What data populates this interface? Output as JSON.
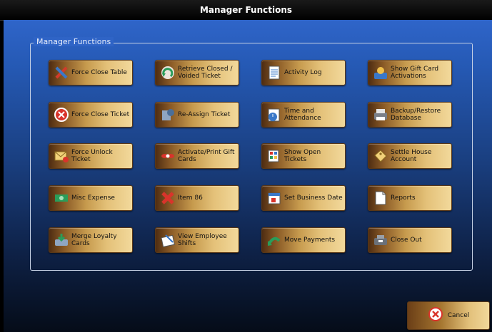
{
  "window": {
    "title": "Manager Functions"
  },
  "group": {
    "label": "Manager Functions"
  },
  "buttons": [
    {
      "name": "force-close-table-button",
      "icon": "tools-icon",
      "label": "Force Close Table"
    },
    {
      "name": "retrieve-closed-voided-ticket-button",
      "icon": "retrieve-arrow-icon",
      "label": "Retrieve Closed / Voided Ticket"
    },
    {
      "name": "activity-log-button",
      "icon": "log-document-icon",
      "label": "Activity Log"
    },
    {
      "name": "show-gift-card-activations-button",
      "icon": "user-card-icon",
      "label": "Show Gift Card Activations"
    },
    {
      "name": "force-close-ticket-button",
      "icon": "stop-circle-icon",
      "label": "Force Close Ticket"
    },
    {
      "name": "re-assign-ticket-button",
      "icon": "reassign-icon",
      "label": "Re-Assign Ticket"
    },
    {
      "name": "time-and-attendance-button",
      "icon": "timesheet-icon",
      "label": "Time and Attendance"
    },
    {
      "name": "backup-restore-database-button",
      "icon": "printer-disk-icon",
      "label": "Backup/Restore Database"
    },
    {
      "name": "force-unlock-ticket-button",
      "icon": "envelope-unlock-icon",
      "label": "Force Unlock Ticket"
    },
    {
      "name": "activate-print-gift-cards-button",
      "icon": "gift-icon",
      "label": "Activate/Print Gift Cards"
    },
    {
      "name": "show-open-tickets-button",
      "icon": "tickets-icon",
      "label": "Show Open Tickets"
    },
    {
      "name": "settle-house-account-button",
      "icon": "tag-icon",
      "label": "Settle House Account"
    },
    {
      "name": "misc-expense-button",
      "icon": "money-icon",
      "label": "Misc Expense"
    },
    {
      "name": "item-86-button",
      "icon": "red-x-icon",
      "label": "Item 86"
    },
    {
      "name": "set-business-date-button",
      "icon": "calendar-icon",
      "label": "Set Business Date"
    },
    {
      "name": "reports-button",
      "icon": "report-page-icon",
      "label": "Reports"
    },
    {
      "name": "merge-loyalty-cards-button",
      "icon": "merge-card-icon",
      "label": "Merge Loyalty Cards"
    },
    {
      "name": "view-employee-shifts-button",
      "icon": "shifts-icon",
      "label": "View Employee Shifts"
    },
    {
      "name": "move-payments-button",
      "icon": "green-arrow-icon",
      "label": "Move Payments"
    },
    {
      "name": "close-out-button",
      "icon": "register-icon",
      "label": "Close Out"
    }
  ],
  "cancel": {
    "label": "Cancel",
    "icon": "cancel-x-icon"
  },
  "colors": {
    "accent_blue": "#2f65c9",
    "button_gold": "#e4c179",
    "button_brown": "#6b3f17"
  }
}
